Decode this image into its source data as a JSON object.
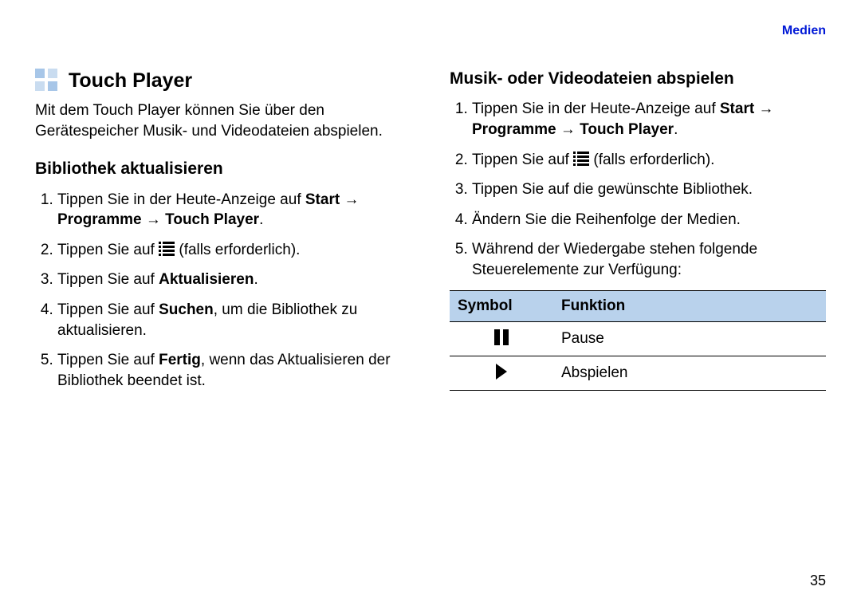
{
  "header": {
    "section_label": "Medien"
  },
  "page_number": "35",
  "left": {
    "title": "Touch Player",
    "intro": "Mit dem Touch Player können Sie über den Gerätespeicher Musik- und Videodateien abspielen.",
    "subheading": "Bibliothek aktualisieren",
    "steps": {
      "s1_a": "Tippen Sie in der Heute-Anzeige auf ",
      "s1_b": "Start → Programme → Touch Player",
      "s1_c": ".",
      "s2_a": "Tippen Sie auf ",
      "s2_b": " (falls erforderlich).",
      "s3_a": "Tippen Sie auf ",
      "s3_b": "Aktualisieren",
      "s3_c": ".",
      "s4_a": "Tippen Sie auf ",
      "s4_b": "Suchen",
      "s4_c": ", um die Bibliothek zu aktualisieren.",
      "s5_a": "Tippen Sie auf ",
      "s5_b": "Fertig",
      "s5_c": ", wenn das Aktualisieren der Bibliothek beendet ist."
    }
  },
  "right": {
    "subheading": "Musik- oder Videodateien abspielen",
    "steps": {
      "s1_a": "Tippen Sie in der Heute-Anzeige auf ",
      "s1_b": "Start → Programme → Touch Player",
      "s1_c": ".",
      "s2_a": "Tippen Sie auf ",
      "s2_b": " (falls erforderlich).",
      "s3": "Tippen Sie auf die gewünschte Bibliothek.",
      "s4": "Ändern Sie die Reihenfolge der Medien.",
      "s5": "Während der Wiedergabe stehen folgende Steuerelemente zur Verfügung:"
    },
    "table": {
      "head_symbol": "Symbol",
      "head_function": "Funktion",
      "row1_function": "Pause",
      "row2_function": "Abspielen"
    }
  }
}
